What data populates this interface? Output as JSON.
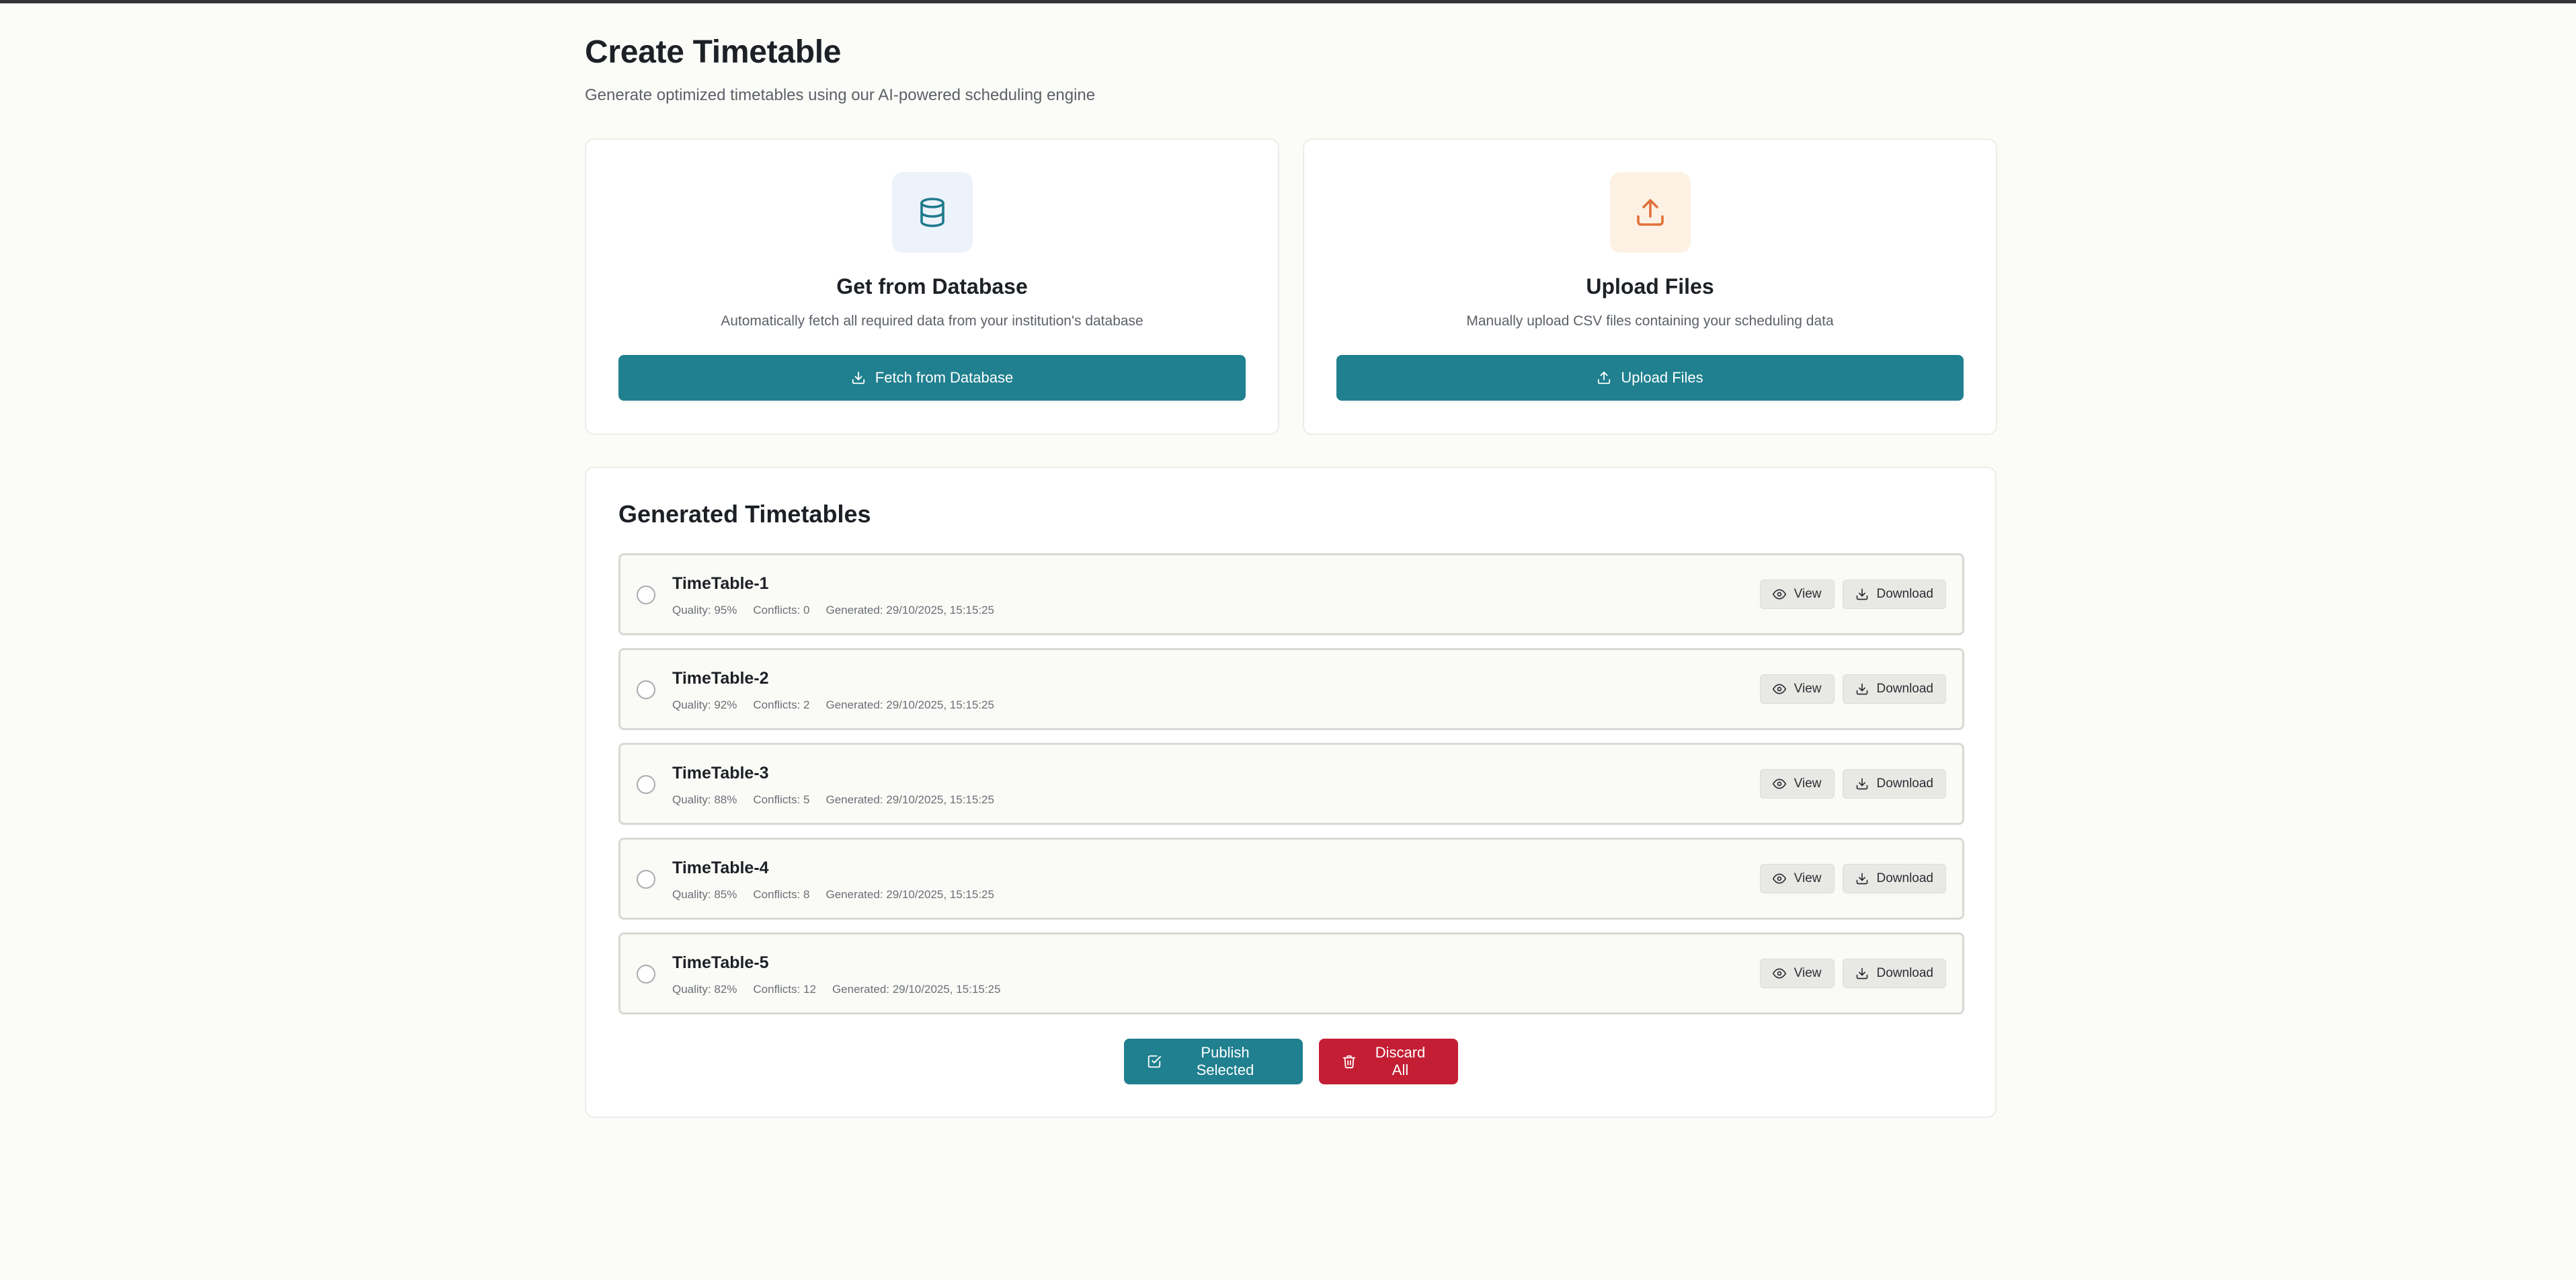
{
  "header": {
    "title": "Create Timetable",
    "subtitle": "Generate optimized timetables using our AI-powered scheduling engine"
  },
  "sources": {
    "database": {
      "icon": "database-icon",
      "title": "Get from Database",
      "description": "Automatically fetch all required data from your institution's database",
      "button_label": "Fetch from Database",
      "button_icon": "download-icon"
    },
    "upload": {
      "icon": "upload-icon",
      "title": "Upload Files",
      "description": "Manually upload CSV files containing your scheduling data",
      "button_label": "Upload Files",
      "button_icon": "upload-icon"
    }
  },
  "generated": {
    "title": "Generated Timetables",
    "view_label": "View",
    "download_label": "Download",
    "items": [
      {
        "name": "TimeTable-1",
        "quality": "Quality: 95%",
        "conflicts": "Conflicts: 0",
        "generated": "Generated: 29/10/2025, 15:15:25",
        "selected": false
      },
      {
        "name": "TimeTable-2",
        "quality": "Quality: 92%",
        "conflicts": "Conflicts: 2",
        "generated": "Generated: 29/10/2025, 15:15:25",
        "selected": false
      },
      {
        "name": "TimeTable-3",
        "quality": "Quality: 88%",
        "conflicts": "Conflicts: 5",
        "generated": "Generated: 29/10/2025, 15:15:25",
        "selected": false
      },
      {
        "name": "TimeTable-4",
        "quality": "Quality: 85%",
        "conflicts": "Conflicts: 8",
        "generated": "Generated: 29/10/2025, 15:15:25",
        "selected": false
      },
      {
        "name": "TimeTable-5",
        "quality": "Quality: 82%",
        "conflicts": "Conflicts: 12",
        "generated": "Generated: 29/10/2025, 15:15:25",
        "selected": false
      }
    ]
  },
  "actions": {
    "publish_label": "Publish Selected",
    "discard_label": "Discard All"
  },
  "colors": {
    "primary": "#20808f",
    "danger": "#c41e34",
    "background": "#fbfbf8"
  }
}
